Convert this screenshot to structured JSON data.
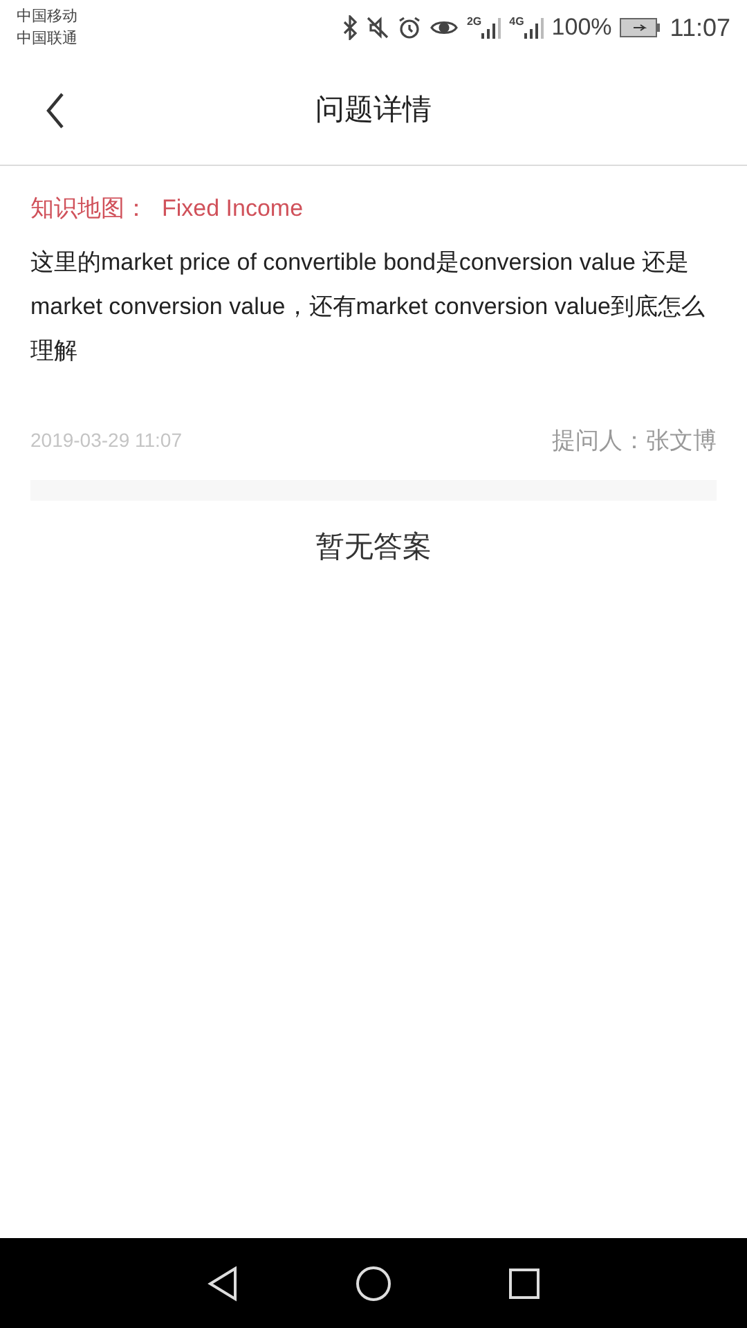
{
  "status_bar": {
    "carriers": [
      "中国移动",
      "中国联通"
    ],
    "signal_labels": [
      "2G",
      "4G"
    ],
    "battery": "100%",
    "time": "11:07"
  },
  "header": {
    "title": "问题详情"
  },
  "question": {
    "topic_label": "知识地图：",
    "topic": "Fixed Income",
    "text": "这里的market price of convertible bond是conversion value 还是market conversion value，还有market conversion value到底怎么理解",
    "date": "2019-03-29 11:07",
    "asker": "提问人：张文博"
  },
  "answers": {
    "empty_text": "暂无答案"
  }
}
